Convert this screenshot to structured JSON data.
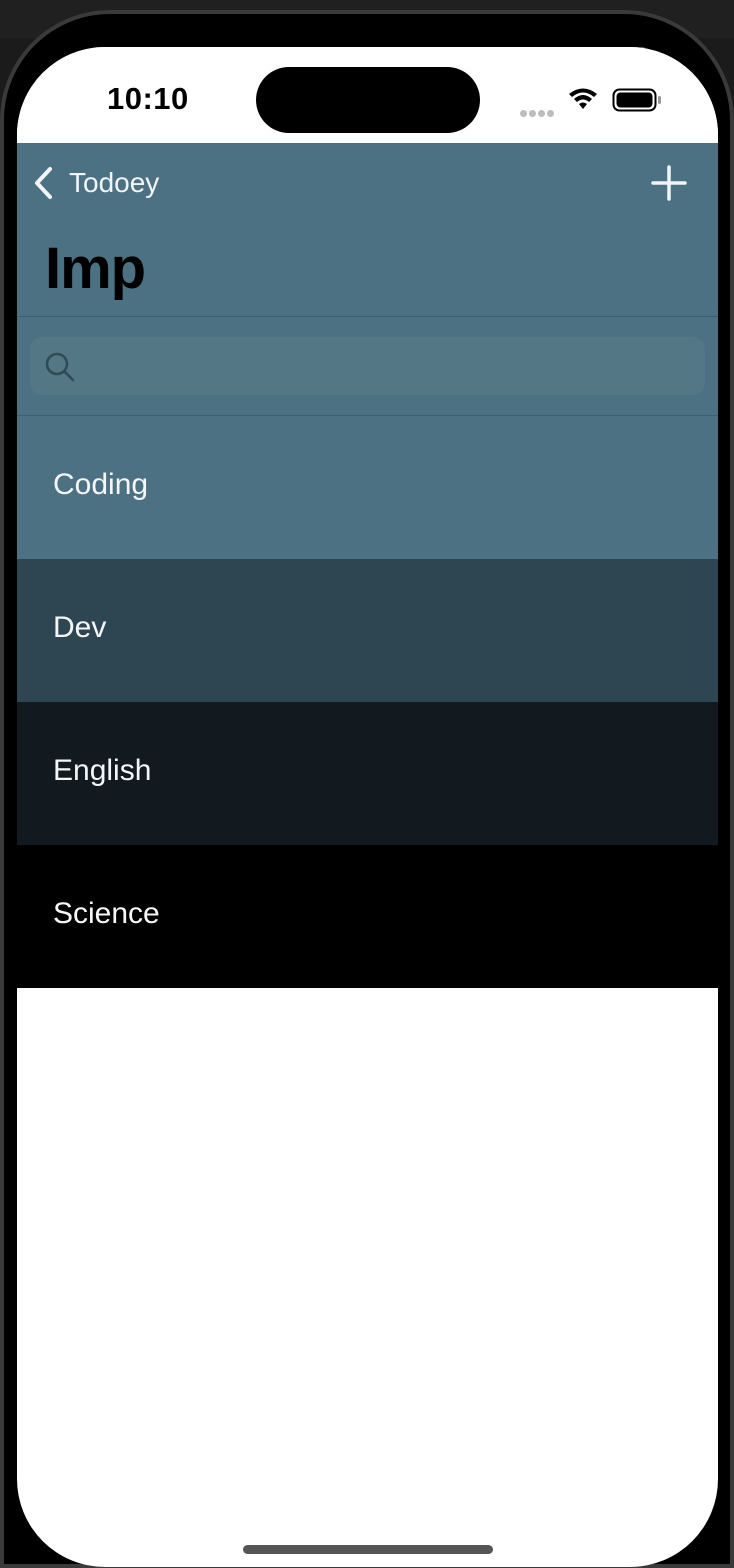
{
  "status_bar": {
    "time": "10:10"
  },
  "nav": {
    "back_label": "Todoey",
    "title": "Imp",
    "add_icon": "plus-icon",
    "back_icon": "chevron-left-icon"
  },
  "search": {
    "placeholder": "",
    "value": "",
    "icon": "search-icon"
  },
  "items": [
    {
      "label": "Coding",
      "color": "#4b7183"
    },
    {
      "label": "Dev",
      "color": "#2e4652"
    },
    {
      "label": "English",
      "color": "#121a20"
    },
    {
      "label": "Science",
      "color": "#000000"
    }
  ],
  "colors": {
    "nav_background": "#4b7183",
    "nav_text": "#f2f5f7"
  }
}
